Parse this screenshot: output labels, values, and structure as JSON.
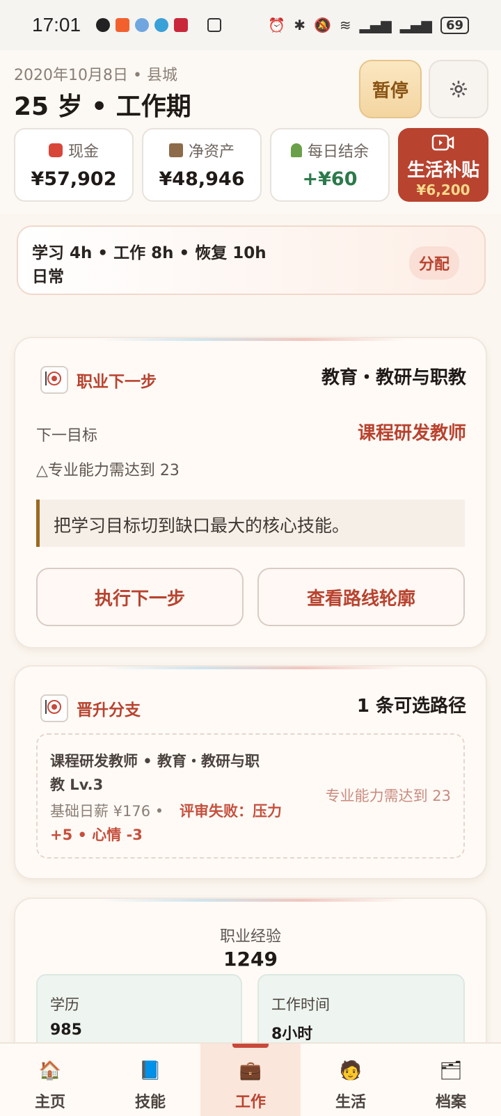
{
  "status_bar": {
    "time": "17:01",
    "battery": "69"
  },
  "header": {
    "date": "2020年10月8日 • 县城",
    "age_stage": "25 岁 • 工作期",
    "pause_label": "暂停"
  },
  "stats": [
    {
      "label": "现金",
      "value": "¥57,902",
      "icon": "money-bag-icon"
    },
    {
      "label": "净资产",
      "value": "¥48,946",
      "icon": "building-icon"
    },
    {
      "label": "每日结余",
      "value": "+¥60",
      "icon": "sprout-icon"
    }
  ],
  "subsidy": {
    "label": "生活补贴",
    "amount": "¥6,200"
  },
  "allocation": {
    "line1": "学习 4h • 工作 8h • 恢复 10h",
    "line2": "日常",
    "button": "分配"
  },
  "career_next": {
    "title": "职业下一步",
    "field": "教育・教研与职教",
    "next_label": "下一目标",
    "next_value": "课程研发教师",
    "requirement": "△专业能力需达到 23",
    "tip": "把学习目标切到缺口最大的核心技能。",
    "btn_execute": "执行下一步",
    "btn_route": "查看路线轮廓"
  },
  "promotion": {
    "title": "晋升分支",
    "count": "1 条可选路径",
    "path_line1": "课程研发教师 • 教育・教研与职",
    "path_line2": "教 Lv.3",
    "salary": "基础日薪 ¥176 •",
    "fail_1": "评审失败：压力",
    "fail_2": "+5 • 心情 -3",
    "requirement": "专业能力需达到 23"
  },
  "experience": {
    "label": "职业经验",
    "value": "1249",
    "edu_label": "学历",
    "edu_value": "985",
    "worktime_label": "工作时间",
    "worktime_value": "8小时"
  },
  "nav": [
    {
      "label": "主页",
      "icon": "house-icon"
    },
    {
      "label": "技能",
      "icon": "book-icon"
    },
    {
      "label": "工作",
      "icon": "briefcase-icon",
      "active": true
    },
    {
      "label": "生活",
      "icon": "person-icon"
    },
    {
      "label": "档案",
      "icon": "archive-icon"
    }
  ],
  "colors": {
    "accent": "#b8432f",
    "gold": "#8a5416",
    "positive": "#2c7a4a",
    "card_bg": "#fffaf6"
  }
}
